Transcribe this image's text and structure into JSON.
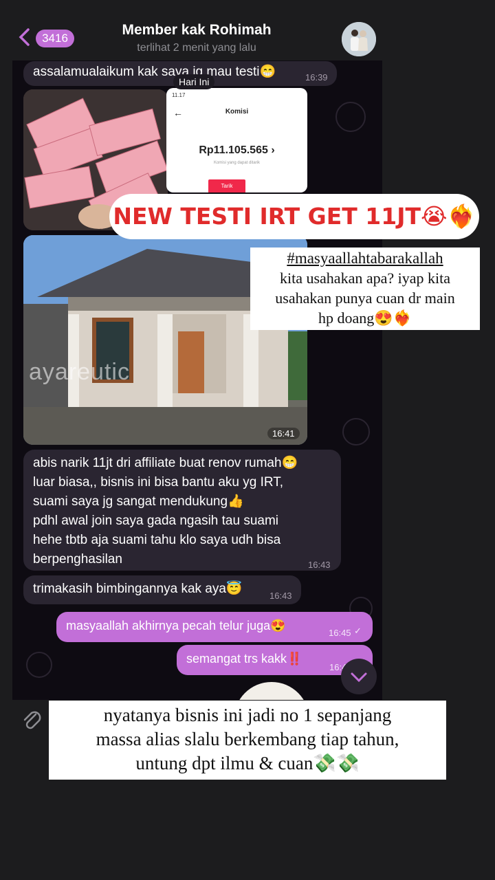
{
  "header": {
    "unread_count": "3416",
    "chat_title": "Member kak Rohimah",
    "last_seen": "terlihat 2 menit yang lalu"
  },
  "messages": {
    "m1_text": "assalamualaikum kak saya jg mau testi😁",
    "m1_time": "16:39",
    "date_label": "Hari Ini",
    "photo_time": "16:41",
    "photo_watermark": "ayareutic",
    "komisi_title": "Komisi",
    "komisi_amount": "Rp11.105.565",
    "komisi_sub": "Komisi yang dapat ditarik",
    "komisi_button": "Tarik",
    "m2_lines": [
      "abis narik 11jt dri affiliate buat renov rumah😁",
      "luar biasa,, bisnis ini bisa bantu aku yg IRT,",
      "suami saya jg sangat mendukung👍",
      "pdhl awal join saya gada ngasih tau suami",
      "hehe tbtb aja suami tahu klo saya udh bisa",
      "berpenghasilan"
    ],
    "m2_time": "16:43",
    "m3_text": "trimakasih bimbingannya kak aya😇",
    "m3_time": "16:43",
    "m4_text": "masyaallah akhirnya pecah telur juga😍",
    "m4_time": "16:45",
    "m5_text": "semangat trs kakk‼️",
    "m5_time": "16:4"
  },
  "overlays": {
    "headline": "NEW TESTI IRT GET 11JT😭❤️‍🔥",
    "box1_hashtag": "#masyaallahtabarakallah",
    "box1_lines": [
      "kita usahakan apa? iyap kita",
      "usahakan punya cuan dr main",
      "hp doang😍❤️‍🔥"
    ],
    "box2_lines": [
      "nyatanya bisnis ini jadi no 1 sepanjang",
      "massa alias slalu berkembang tiap tahun,",
      "untung dpt ilmu & cuan💸💸"
    ]
  },
  "colors": {
    "outgoing_bubble": "#c26fd8",
    "incoming_bubble": "#2a2531",
    "headline_red": "#e02b2b"
  }
}
